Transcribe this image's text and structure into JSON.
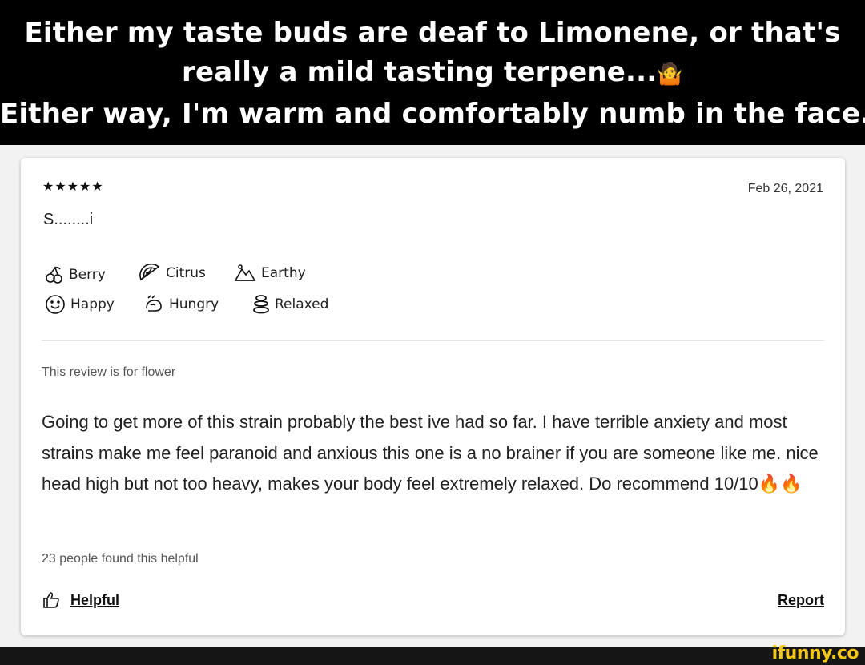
{
  "caption": {
    "line1": "Either my taste buds are deaf to Limonene, or that's",
    "line2": "really a mild tasting terpene...",
    "line2_emoji": "🤷",
    "line3": "Either way, I'm warm and comfortably numb in the face."
  },
  "review": {
    "stars": "★★★★★",
    "rating": 5,
    "date": "Feb 26, 2021",
    "title": "S........i",
    "flavors": [
      {
        "label": "Berry",
        "icon": "cherry-icon"
      },
      {
        "label": "Citrus",
        "icon": "citrus-slice-icon"
      },
      {
        "label": "Earthy",
        "icon": "mountain-icon"
      }
    ],
    "feelings": [
      {
        "label": "Happy",
        "icon": "smiley-icon"
      },
      {
        "label": "Hungry",
        "icon": "food-icon"
      },
      {
        "label": "Relaxed",
        "icon": "stones-icon"
      }
    ],
    "review_for": "This review is for flower",
    "body": "Going to get more of this strain probably the best ive had so far. I have terrible anxiety and most strains make me feel paranoid and anxious this one is a no brainer if you are someone like me. nice head high but not too heavy, makes your body feel extremely relaxed.  Do recommend 10/10🔥🔥",
    "helpful_count": "23 people found this helpful",
    "helpful_label": "Helpful",
    "report_label": "Report"
  },
  "watermark": "ifunny.co",
  "colors": {
    "caption_bg": "#000000",
    "caption_text": "#ffffff",
    "card_bg": "#ffffff",
    "watermark": "#f3c718"
  }
}
